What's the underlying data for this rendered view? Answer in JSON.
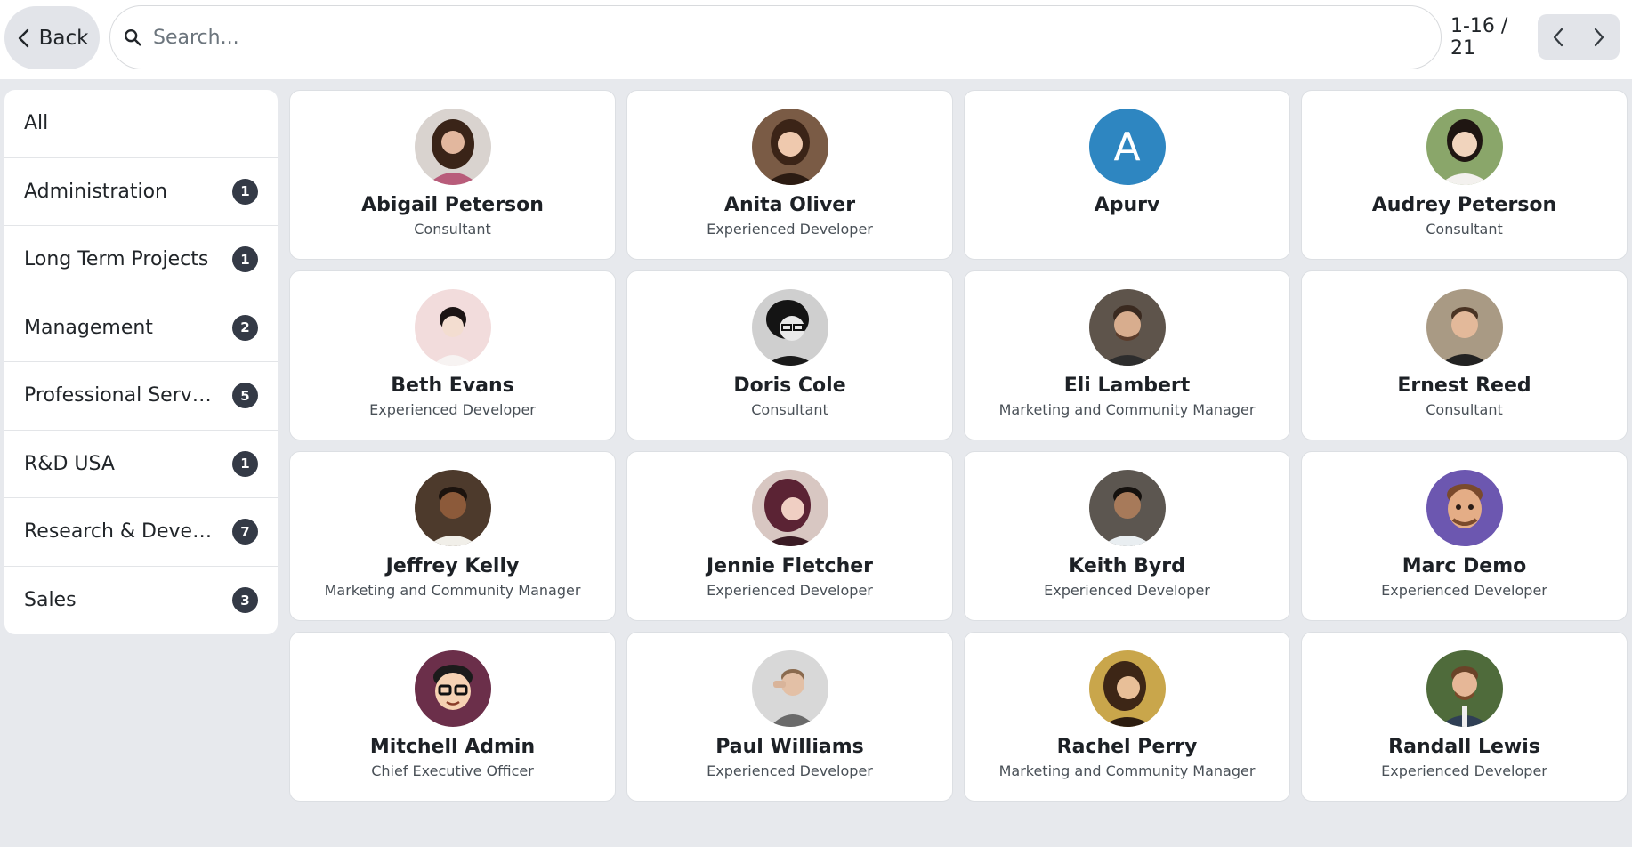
{
  "toolbar": {
    "back_label": "Back",
    "search_placeholder": "Search...",
    "pager_value": "1-16 / 21"
  },
  "sidebar": {
    "items": [
      {
        "label": "All",
        "count": ""
      },
      {
        "label": "Administration",
        "count": "1"
      },
      {
        "label": "Long Term Projects",
        "count": "1"
      },
      {
        "label": "Management",
        "count": "2"
      },
      {
        "label": "Professional Services",
        "count": "5"
      },
      {
        "label": "R&D USA",
        "count": "1"
      },
      {
        "label": "Research & Develo…",
        "count": "7"
      },
      {
        "label": "Sales",
        "count": "3"
      }
    ]
  },
  "employees": [
    {
      "name": "Abigail Peterson",
      "role": "Consultant"
    },
    {
      "name": "Anita Oliver",
      "role": "Experienced Developer"
    },
    {
      "name": "Apurv",
      "role": "",
      "initial": "A"
    },
    {
      "name": "Audrey Peterson",
      "role": "Consultant"
    },
    {
      "name": "Beth Evans",
      "role": "Experienced Developer"
    },
    {
      "name": "Doris Cole",
      "role": "Consultant"
    },
    {
      "name": "Eli Lambert",
      "role": "Marketing and Community Manager"
    },
    {
      "name": "Ernest Reed",
      "role": "Consultant"
    },
    {
      "name": "Jeffrey Kelly",
      "role": "Marketing and Community Manager"
    },
    {
      "name": "Jennie Fletcher",
      "role": "Experienced Developer"
    },
    {
      "name": "Keith Byrd",
      "role": "Experienced Developer"
    },
    {
      "name": "Marc Demo",
      "role": "Experienced Developer"
    },
    {
      "name": "Mitchell Admin",
      "role": "Chief Executive Officer"
    },
    {
      "name": "Paul Williams",
      "role": "Experienced Developer"
    },
    {
      "name": "Rachel Perry",
      "role": "Marketing and Community Manager"
    },
    {
      "name": "Randall Lewis",
      "role": "Experienced Developer"
    }
  ],
  "colors": {
    "background": "#e7e9ed",
    "count_badge": "#343a46",
    "letter_avatar": "#2e86c1"
  }
}
